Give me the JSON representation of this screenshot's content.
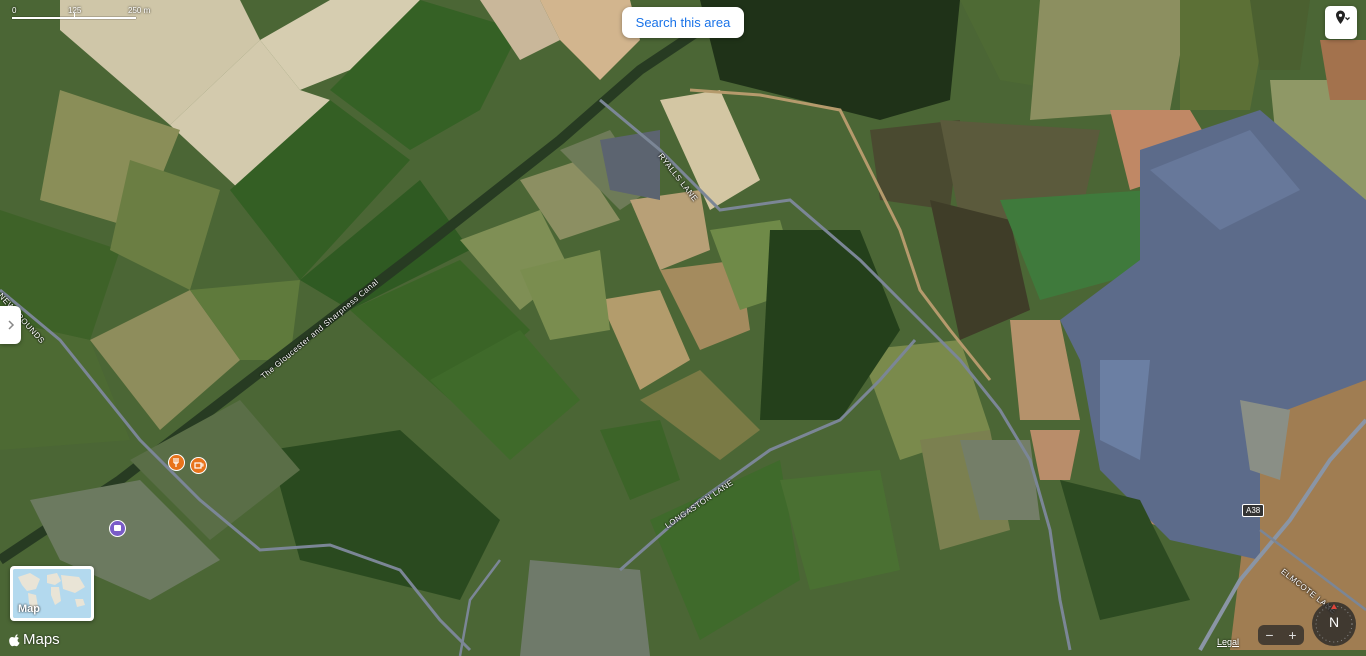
{
  "scale": {
    "ticks": [
      "0",
      "125",
      "250 m"
    ]
  },
  "search_area_label": "Search this area",
  "map_mode_label": "Map",
  "brand_label": "Maps",
  "legal_label": "Legal",
  "compass_label": "N",
  "zoom": {
    "out_label": "−",
    "in_label": "+"
  },
  "road_labels": {
    "canal": "The Gloucester and Sharpness Canal",
    "ryalls_lane": "RYALLS LANE",
    "longaston_lane": "LONGASTON LANE",
    "newgrounds": "NEWGROUNDS",
    "elmcote_lane": "ELMCOTE LANE",
    "a38": "A38"
  },
  "icons": {
    "pin": "location-pin-icon",
    "chevron": "chevron-down-icon",
    "side": "chevron-right-icon",
    "poi_food": "restaurant-icon",
    "poi_cafe": "cafe-icon",
    "poi_transit": "transit-icon",
    "apple": "apple-logo-icon"
  },
  "colors": {
    "accent": "#1a73e8",
    "poi_orange": "#e8731b",
    "poi_purple": "#7a5cc8"
  }
}
